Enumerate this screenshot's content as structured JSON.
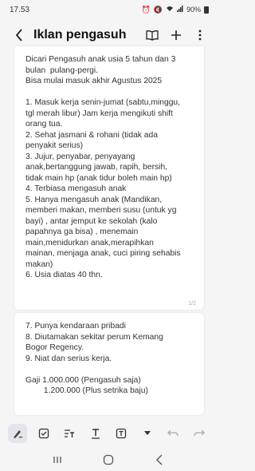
{
  "status_bar": {
    "time": "17.53",
    "battery": "90%"
  },
  "header": {
    "title": "Iklan pengasuh"
  },
  "note": {
    "page1_text": "Dicari Pengasuh anak usia 5 tahun dan 3\nbulan  pulang-pergi.\nBisa mulai masuk akhir Agustus 2025\n\n1. Masuk kerja senin-jumat (sabtu,minggu,\ntgl merah libur) Jam kerja mengikuti shift\norang tua.\n2. Sehat jasmani & rohani (tidak ada\npenyakit serius)\n3. Jujur, penyabar, penyayang\nanak,bertanggung jawab, rapih, bersih,\ntidak main hp (anak tidur boleh main hp)\n4. Terbiasa mengasuh anak\n5. Hanya mengasuh anak (Mandikan,\nmemberi makan, memberi susu (untuk yg\nbayi) , antar jemput ke sekolah (kalo\npapahnya ga bisa) , menemain\nmain,menidurkan anak,merapihkan\nmainan, menjaga anak, cuci piring sehabis\nmakan)\n6. Usia diatas 40 thn.",
    "page1_number": "1/2",
    "page2_text": "7. Punya kendaraan pribadi\n8. Diutamakan sekitar perum Kemang\nBogor Regency.\n9. Niat dan serius kerja.\n\nGaji 1.000.000 (Pengasuh saja)\n        1.200.000 (Plus setrika baju)"
  }
}
